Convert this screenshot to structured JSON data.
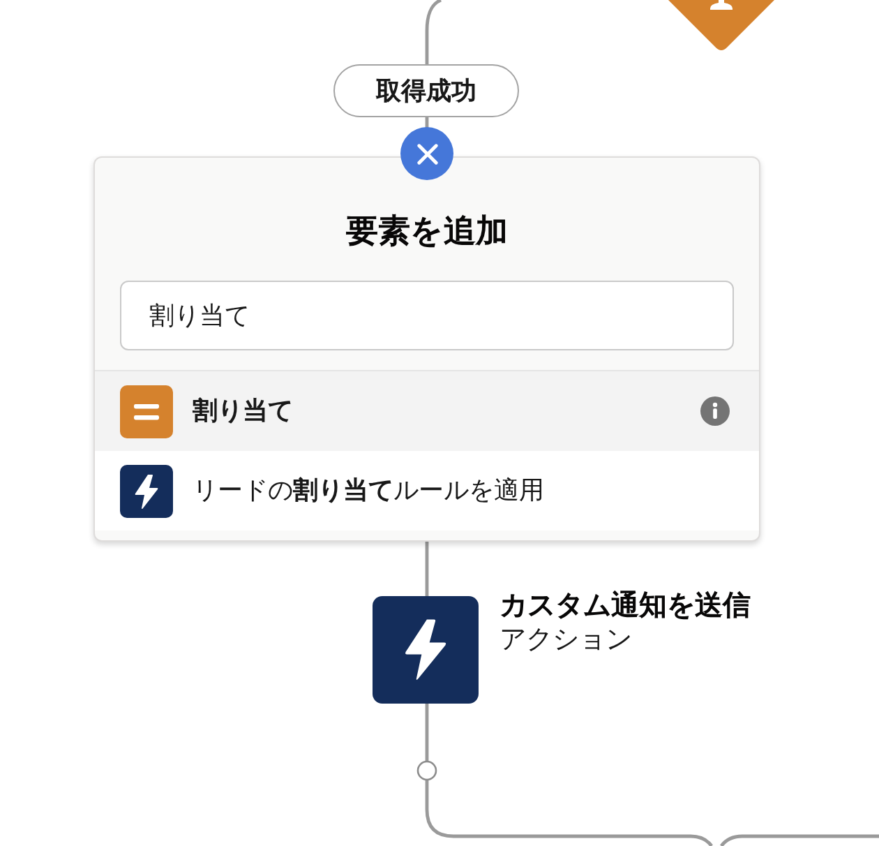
{
  "canvas": {
    "outcome_label": "取得成功",
    "add_element_panel": {
      "title": "要素を追加",
      "search": {
        "value": "割り当て"
      },
      "results": [
        {
          "kind": "element",
          "label": "割り当て",
          "selected": true
        },
        {
          "kind": "action",
          "label": "リードの**割り当て**ルールを適用",
          "selected": false
        }
      ]
    },
    "action_node": {
      "kind": "action",
      "title": "カスタム通知を送信",
      "subtitle": "アクション"
    }
  }
}
